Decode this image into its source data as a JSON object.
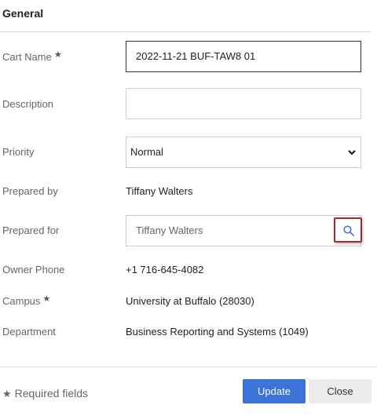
{
  "section": {
    "title": "General"
  },
  "form": {
    "cart_name": {
      "label": "Cart Name",
      "required_mark": "★",
      "value": "2022-11-21 BUF-TAW8 01"
    },
    "description": {
      "label": "Description",
      "value": ""
    },
    "priority": {
      "label": "Priority",
      "selected": "Normal"
    },
    "prepared_by": {
      "label": "Prepared by",
      "value": "Tiffany Walters"
    },
    "prepared_for": {
      "label": "Prepared for",
      "value": "Tiffany Walters"
    },
    "owner_phone": {
      "label": "Owner Phone",
      "value": "+1 716-645-4082"
    },
    "campus": {
      "label": "Campus",
      "required_mark": "★",
      "value": "University at Buffalo (28030)"
    },
    "department": {
      "label": "Department",
      "value": "Business Reporting and Systems (1049)"
    }
  },
  "footer": {
    "required_star": "★",
    "required_note": "Required fields",
    "update_label": "Update",
    "close_label": "Close"
  },
  "icons": {
    "search": "search-icon",
    "chevron": "chevron-down-icon",
    "star": "star-icon"
  },
  "colors": {
    "primary": "#3b73d9",
    "highlight_border": "#a52a2a"
  }
}
